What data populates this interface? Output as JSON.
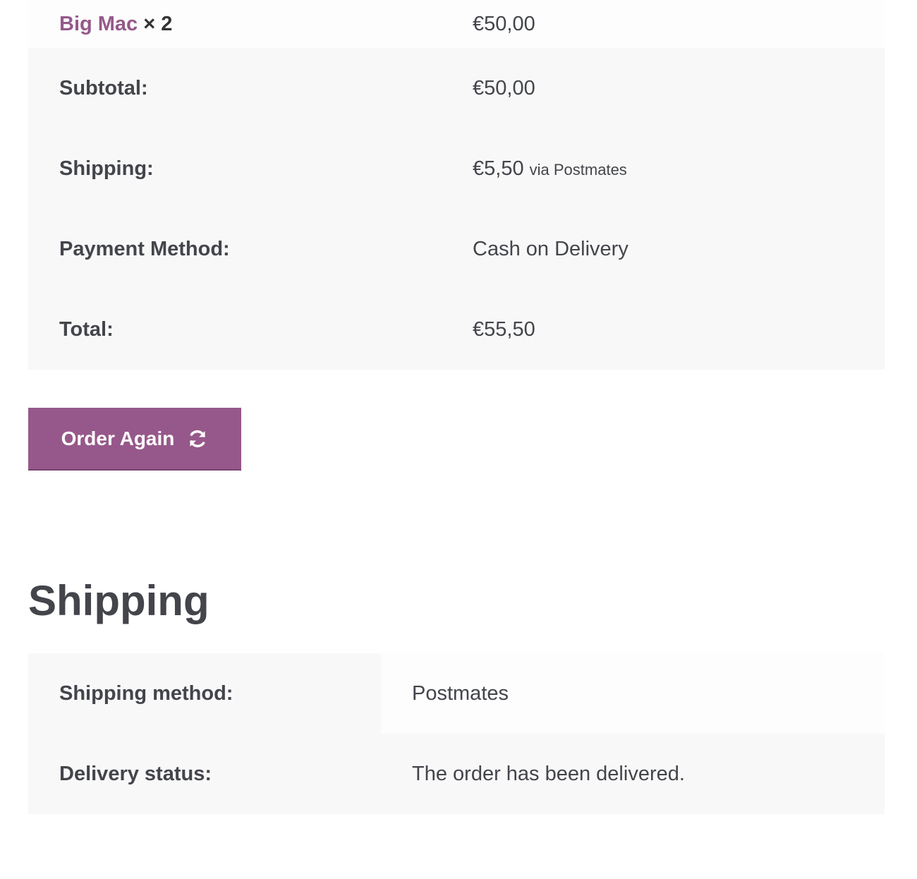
{
  "order": {
    "item": {
      "name": "Big Mac",
      "qty": "× 2",
      "price": "€50,00"
    },
    "totals": [
      {
        "label": "Subtotal:",
        "value": "€50,00",
        "note": ""
      },
      {
        "label": "Shipping:",
        "value": "€5,50",
        "note": "via Postmates"
      },
      {
        "label": "Payment Method:",
        "value": "Cash on Delivery",
        "note": ""
      },
      {
        "label": "Total:",
        "value": "€55,50",
        "note": ""
      }
    ],
    "order_again_label": "Order Again",
    "order_again_icon": "refresh-icon"
  },
  "shipping": {
    "title": "Shipping",
    "rows": [
      {
        "label": "Shipping method:",
        "value": "Postmates"
      },
      {
        "label": "Delivery status:",
        "value": "The order has been delivered."
      }
    ]
  },
  "colors": {
    "accent": "#96588a",
    "text": "#43454b",
    "row_bg": "#f8f8f8"
  }
}
